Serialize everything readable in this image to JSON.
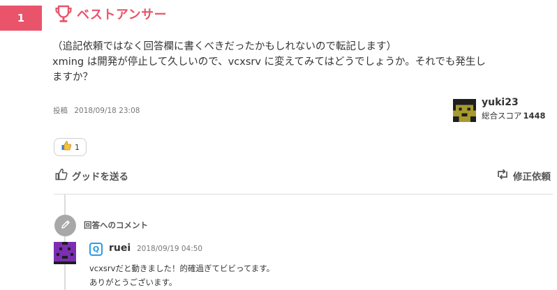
{
  "answer": {
    "rank": "1",
    "best_label": "ベストアンサー",
    "body_lines": [
      "（追記依頼ではなく回答欄に書くべきだったかもしれないので転記します）",
      "xming は開発が停止して久しいので、vcxsrv に変えてみてはどうでしょうか。それでも発生し",
      "ますか？"
    ],
    "posted_label": "投稿",
    "posted_at": "2018/09/18 23:08",
    "like_count": "1",
    "good_label": "グッドを送る",
    "edit_label": "修正依頼",
    "accent_color": "#e9546b"
  },
  "answerer": {
    "name": "yuki23",
    "score_label": "総合スコア",
    "score": "1448",
    "avatar": "pixel-face-avatar-olive"
  },
  "comments": {
    "section_title": "回答へのコメント",
    "items": [
      {
        "badge": "Q",
        "name": "ruei",
        "date": "2018/09/19 04:50",
        "lines": [
          "vcxsrvだと動きました！的確過ぎてビビってます。",
          "ありがとうございます。"
        ],
        "avatar": "pixel-face-avatar-purple"
      }
    ]
  }
}
